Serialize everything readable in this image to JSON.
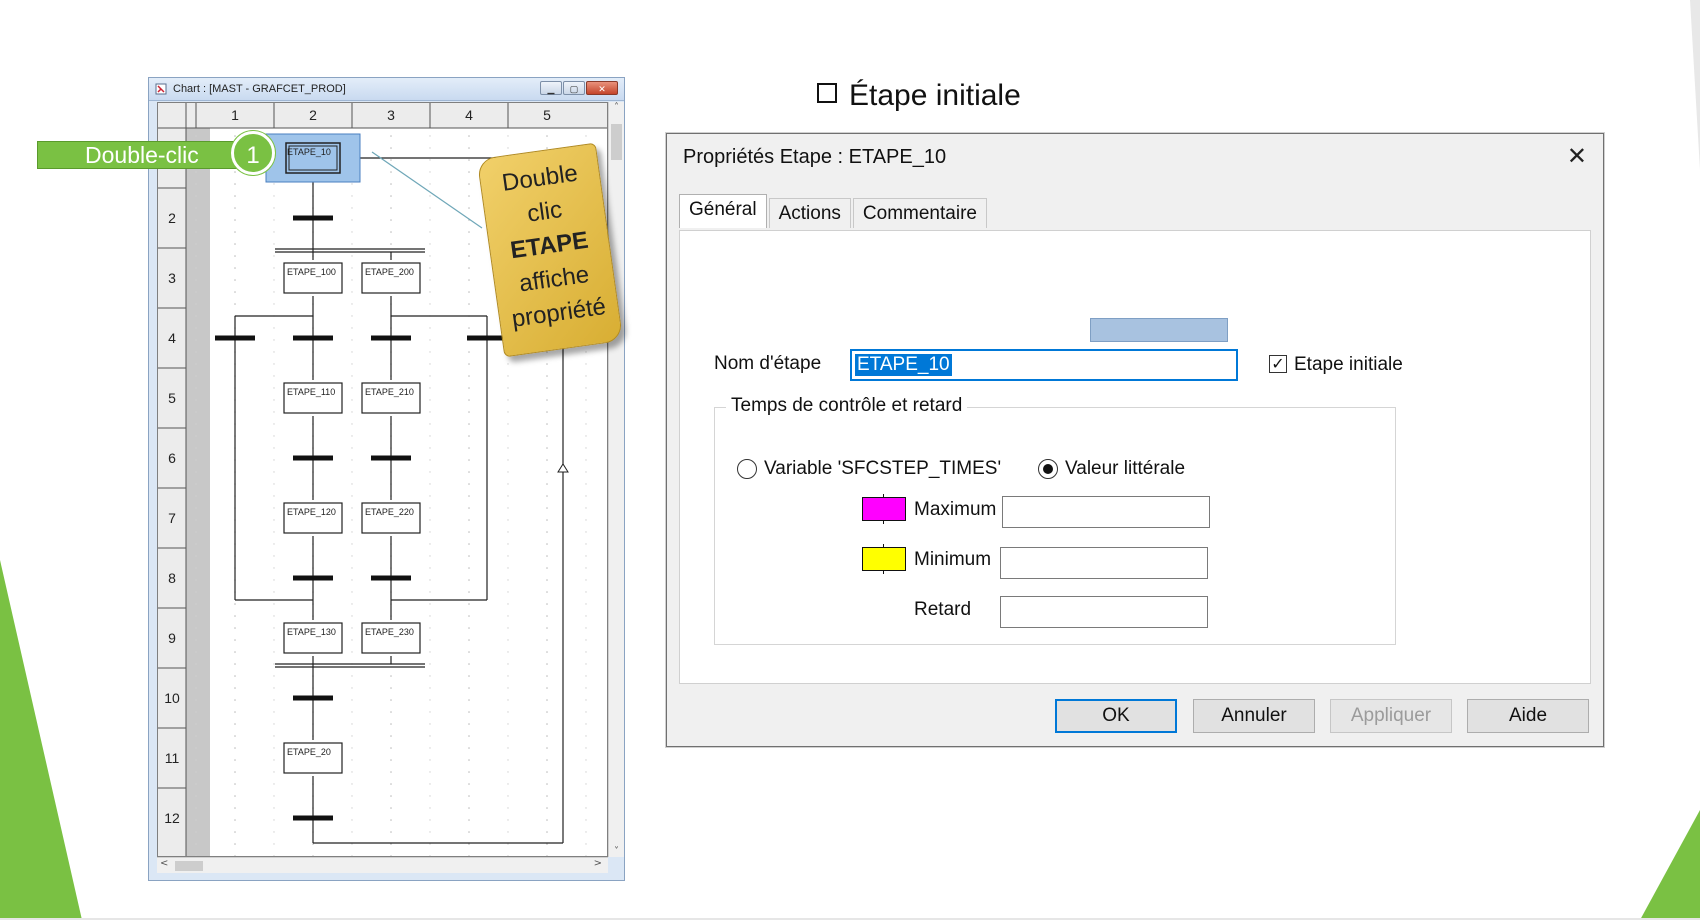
{
  "slide": {
    "heading": "Étape initiale",
    "callout_label": "Double-clic",
    "callout_number": "1",
    "note_lines": [
      "Double",
      "clic",
      "ETAPE",
      "affiche",
      "propriété"
    ],
    "colors": {
      "accent_green": "#7ac143",
      "note_yellow": "#e8c24f"
    }
  },
  "chart_window": {
    "title": "Chart : [MAST - GRAFCET_PROD]",
    "window_buttons": [
      "minimize",
      "maximize",
      "close"
    ],
    "column_headers": [
      "1",
      "2",
      "3",
      "4",
      "5"
    ],
    "row_headers": [
      "2",
      "3",
      "4",
      "5",
      "6",
      "7",
      "8",
      "9",
      "10",
      "11",
      "12"
    ],
    "steps": [
      {
        "label": "ETAPE_10",
        "col": 2,
        "row": 1,
        "initial": true
      },
      {
        "label": "ETAPE_100",
        "col": 2,
        "row": 3
      },
      {
        "label": "ETAPE_200",
        "col": 3,
        "row": 3
      },
      {
        "label": "ETAPE_110",
        "col": 2,
        "row": 5
      },
      {
        "label": "ETAPE_210",
        "col": 3,
        "row": 5
      },
      {
        "label": "ETAPE_120",
        "col": 2,
        "row": 7
      },
      {
        "label": "ETAPE_220",
        "col": 3,
        "row": 7
      },
      {
        "label": "ETAPE_130",
        "col": 2,
        "row": 9
      },
      {
        "label": "ETAPE_230",
        "col": 3,
        "row": 9
      },
      {
        "label": "ETAPE_20",
        "col": 2,
        "row": 11
      }
    ],
    "scroll_arrows": {
      "up": "˄",
      "down": "˅",
      "left": "<",
      "right": ">"
    }
  },
  "dialog": {
    "title": "Propriétés Etape : ETAPE_10",
    "close_glyph": "✕",
    "tabs": [
      "Général",
      "Actions",
      "Commentaire"
    ],
    "active_tab": "Général",
    "step_name_label": "Nom d'étape",
    "step_name_value": "ETAPE_10",
    "initial_step_label": "Etape initiale",
    "initial_step_checked": true,
    "group_title": "Temps de contrôle et retard",
    "radio_variable": "Variable 'SFCSTEP_TIMES'",
    "radio_literal": "Valeur littérale",
    "selected_radio": "Valeur littérale",
    "maximum_label": "Maximum",
    "minimum_label": "Minimum",
    "delay_label": "Retard",
    "maximum_value": "",
    "minimum_value": "",
    "delay_value": "",
    "maximum_color": "#ff00ff",
    "minimum_color": "#ffff00",
    "buttons": {
      "ok": "OK",
      "cancel": "Annuler",
      "apply": "Appliquer",
      "help": "Aide"
    },
    "check_glyph": "✓"
  }
}
